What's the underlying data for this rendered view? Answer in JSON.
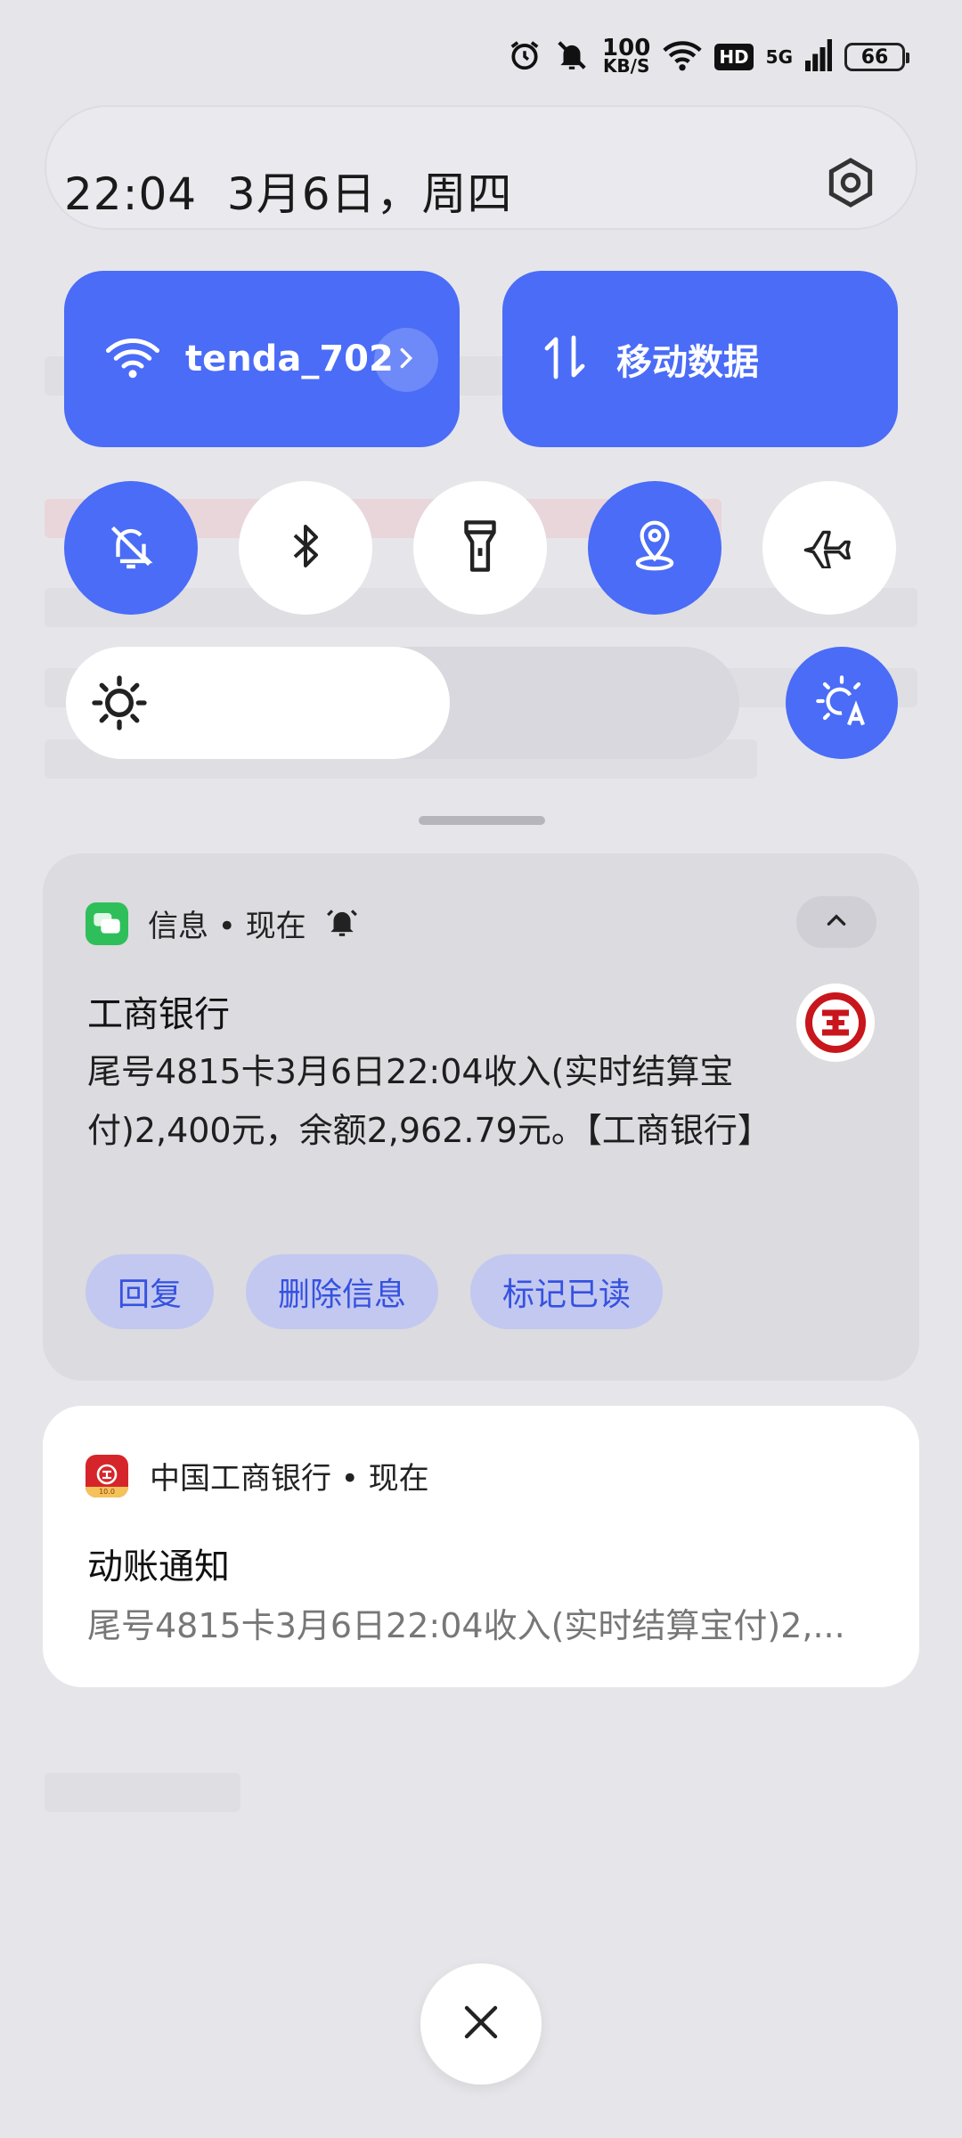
{
  "status_bar": {
    "speed_value": "100",
    "speed_unit": "KB/S",
    "hd": "HD",
    "network": "5G",
    "battery": "66",
    "icons": [
      "alarm-icon",
      "mute-icon",
      "wifi-icon",
      "signal-icon"
    ]
  },
  "header": {
    "time": "22:04",
    "date": "3月6日，周四"
  },
  "tiles": {
    "wifi_label": "tenda_702",
    "mobile_label": "移动数据"
  },
  "toggles": [
    {
      "name": "mute",
      "on": true
    },
    {
      "name": "bluetooth",
      "on": false
    },
    {
      "name": "flashlight",
      "on": false
    },
    {
      "name": "location",
      "on": true
    },
    {
      "name": "airplane",
      "on": false
    }
  ],
  "brightness": {
    "level": 0.57,
    "auto_on": true
  },
  "notification_1": {
    "app": "信息 • 现在",
    "title": "工商银行",
    "body": "尾号4815卡3月6日22:04收入(实时结算宝付)2,400元，余额2,962.79元。【工商银行】",
    "actions": [
      "回复",
      "删除信息",
      "标记已读"
    ]
  },
  "notification_2": {
    "app": "中国工商银行 • 现在",
    "app_badge": "10.0",
    "title": "动账通知",
    "body": "尾号4815卡3月6日22:04收入(实时结算宝付)2,..."
  },
  "colors": {
    "accent": "#4a6cf7",
    "action_bg": "#c3c8f0",
    "action_text": "#3552e0",
    "icbc_red": "#d6252a"
  }
}
